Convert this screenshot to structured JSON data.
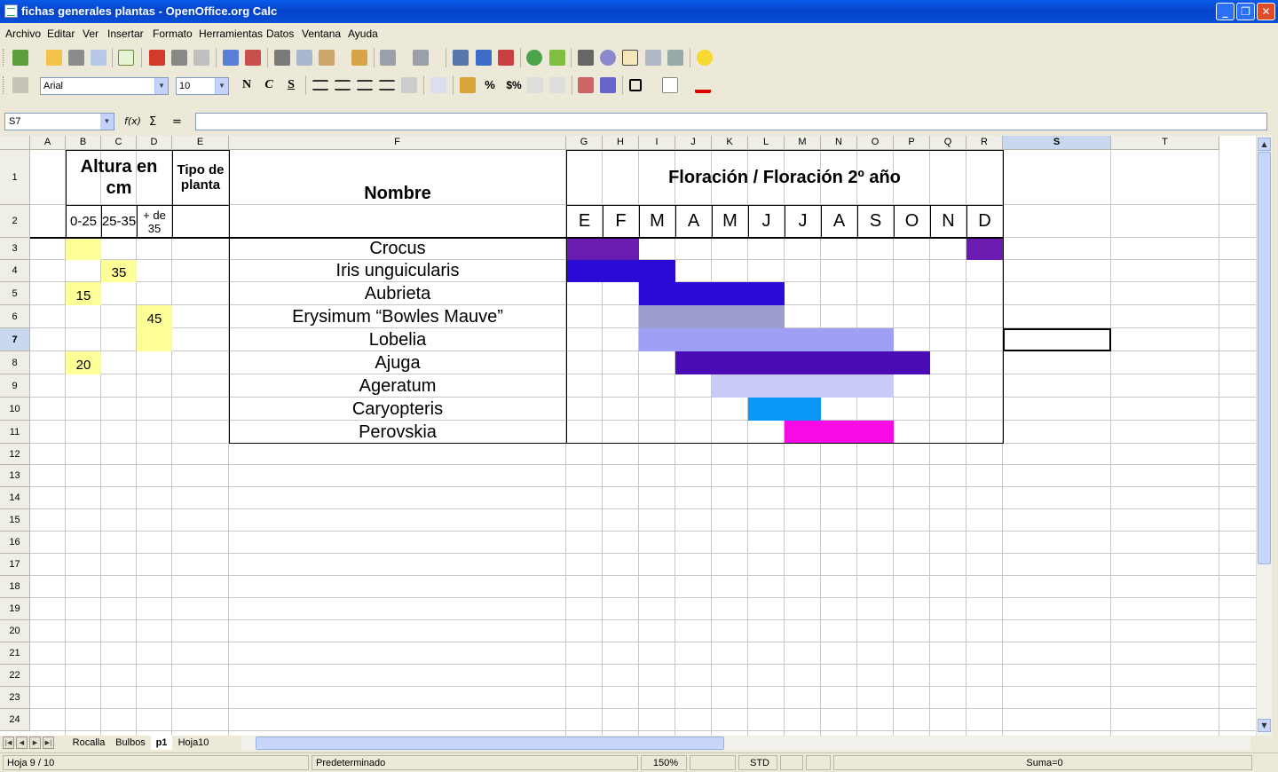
{
  "window": {
    "title": "fichas generales plantas - OpenOffice.org Calc",
    "minimize": "_",
    "maximize": "❐",
    "close": "✕"
  },
  "menu": [
    "Archivo",
    "Editar",
    "Ver",
    "Insertar",
    "Formato",
    "Herramientas",
    "Datos",
    "Ventana",
    "Ayuda"
  ],
  "format_toolbar": {
    "font_name": "Arial",
    "font_size": "10",
    "bold": "N",
    "italic": "C",
    "underline": "S",
    "percent": "%",
    "currency": "$%"
  },
  "formula_bar": {
    "cell_ref": "S7",
    "function_wizard": "f(x)",
    "sum": "Σ",
    "equals": "=",
    "content": ""
  },
  "columns": [
    "A",
    "B",
    "C",
    "D",
    "E",
    "F",
    "G",
    "H",
    "I",
    "J",
    "K",
    "L",
    "M",
    "N",
    "O",
    "P",
    "Q",
    "R",
    "S",
    "T"
  ],
  "rows": [
    "1",
    "2",
    "3",
    "4",
    "5",
    "6",
    "7",
    "8",
    "9",
    "10",
    "11",
    "12",
    "13",
    "14",
    "15",
    "16",
    "17",
    "18",
    "19",
    "20",
    "21",
    "22",
    "23",
    "24"
  ],
  "active_cell": "S7",
  "sheet": {
    "height_header": "Altura en cm",
    "type_header": "Tipo de planta",
    "name_header": "Nombre",
    "flowering_header": "Floración / Floración 2º año",
    "height_ranges": [
      "0-25",
      "25-35",
      "+ de 35"
    ],
    "months": [
      "E",
      "F",
      "M",
      "A",
      "M",
      "J",
      "J",
      "A",
      "S",
      "O",
      "N",
      "D"
    ],
    "plants": [
      {
        "name": "Crocus",
        "h025": "",
        "h2535": "",
        "h35": "",
        "highlight": [
          "B"
        ],
        "bloom": [
          {
            "from": 0,
            "to": 1,
            "color": "#6a1bb0"
          },
          {
            "from": 11,
            "to": 11,
            "color": "#6a1bb0"
          }
        ]
      },
      {
        "name": "Iris unguicularis",
        "h025": "",
        "h2535": "35",
        "h35": "",
        "highlight": [
          "C"
        ],
        "bloom": [
          {
            "from": 0,
            "to": 2,
            "color": "#2a0ad6"
          }
        ]
      },
      {
        "name": "Aubrieta",
        "h025": "15",
        "h2535": "",
        "h35": "",
        "highlight": [
          "B"
        ],
        "bloom": [
          {
            "from": 2,
            "to": 5,
            "color": "#2a0ad6"
          }
        ]
      },
      {
        "name": "Erysimum “Bowles Mauve”",
        "h025": "",
        "h2535": "",
        "h35": "45",
        "highlight": [
          "D"
        ],
        "bloom": [
          {
            "from": 2,
            "to": 5,
            "color": "#9d9dcf"
          }
        ]
      },
      {
        "name": "Lobelia",
        "h025": "",
        "h2535": "",
        "h35": "",
        "highlight": [
          "D"
        ],
        "bloom": [
          {
            "from": 2,
            "to": 8,
            "color": "#9f9ff6"
          }
        ]
      },
      {
        "name": "Ajuga",
        "h025": "20",
        "h2535": "",
        "h35": "",
        "highlight": [
          "B"
        ],
        "bloom": [
          {
            "from": 3,
            "to": 9,
            "color": "#4a0ab6"
          }
        ]
      },
      {
        "name": "Ageratum",
        "h025": "",
        "h2535": "",
        "h35": "",
        "highlight": [],
        "bloom": [
          {
            "from": 4,
            "to": 8,
            "color": "#cacaf6"
          }
        ]
      },
      {
        "name": "Caryopteris",
        "h025": "",
        "h2535": "",
        "h35": "",
        "highlight": [],
        "bloom": [
          {
            "from": 5,
            "to": 6,
            "color": "#0a96f6"
          }
        ]
      },
      {
        "name": "Perovskia",
        "h025": "",
        "h2535": "",
        "h35": "",
        "highlight": [],
        "bloom": [
          {
            "from": 6,
            "to": 8,
            "color": "#f60ae6"
          }
        ]
      }
    ]
  },
  "sheet_tabs": [
    "Rocalla",
    "Bulbos",
    "p1",
    "Hoja10"
  ],
  "active_tab": "p1",
  "status": {
    "sheet": "Hoja 9 / 10",
    "style": "Predeterminado",
    "zoom": "150%",
    "mode": "STD",
    "sum": "Suma=0"
  },
  "colors": {
    "height_highlight": "#ffff99",
    "title_bar": "#0a4fd8",
    "selected_header": "#c9d7ef"
  }
}
